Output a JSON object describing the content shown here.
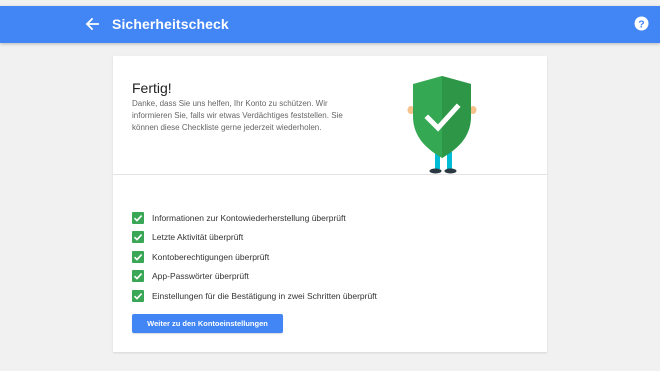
{
  "header": {
    "title": "Sicherheitscheck",
    "back_icon": "arrow-back-icon",
    "help_icon": "help-circle-icon",
    "color": "#4285f4"
  },
  "done": {
    "title": "Fertig!",
    "text": "Danke, dass Sie uns helfen, Ihr Konto zu schützen. Wir informieren Sie, falls wir etwas Verdächtiges feststellen. Sie können diese Checkliste gerne jederzeit wiederholen.",
    "illustration_icon": "security-shield-check-icon",
    "shield_color": "#34a853"
  },
  "checklist": [
    {
      "label": "Informationen zur Kontowiederherstellung überprüft",
      "checked": true
    },
    {
      "label": "Letzte Aktivität überprüft",
      "checked": true
    },
    {
      "label": "Kontoberechtigungen überprüft",
      "checked": true
    },
    {
      "label": "App-Passwörter überprüft",
      "checked": true
    },
    {
      "label": "Einstellungen für die Bestätigung in zwei Schritten überprüft",
      "checked": true
    }
  ],
  "checkbox_color": "#3aa757",
  "primary_button": {
    "label": "Weiter zu den Kontoeinstellungen",
    "color": "#4285f4"
  }
}
